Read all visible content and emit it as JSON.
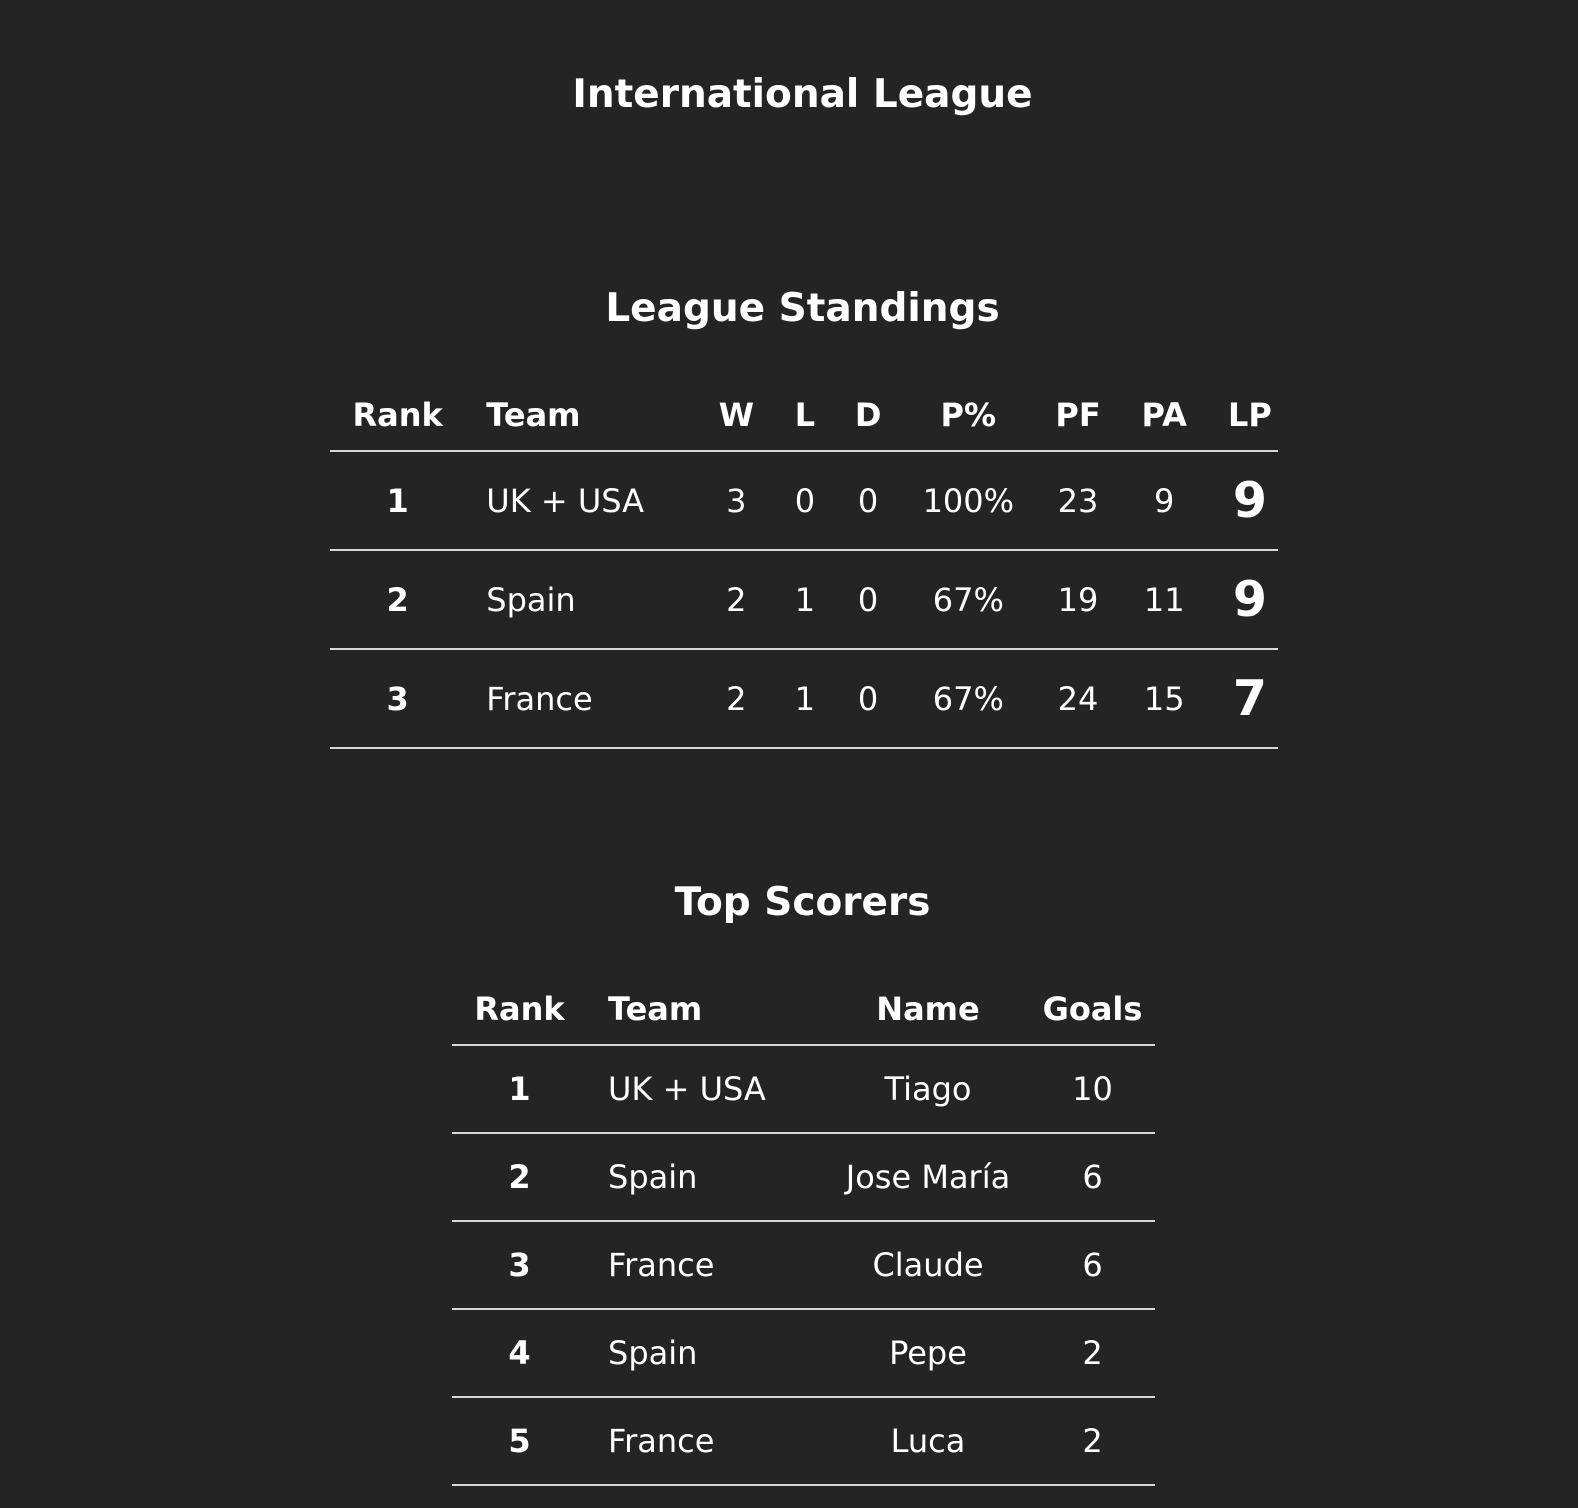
{
  "page": {
    "title": "International League"
  },
  "standings": {
    "title": "League Standings",
    "headers": {
      "rank": "Rank",
      "team": "Team",
      "w": "W",
      "l": "L",
      "d": "D",
      "pct": "P%",
      "pf": "PF",
      "pa": "PA",
      "lp": "LP"
    },
    "rows": [
      {
        "rank": "1",
        "team": "UK + USA",
        "w": "3",
        "l": "0",
        "d": "0",
        "pct": "100%",
        "pf": "23",
        "pa": "9",
        "lp": "9"
      },
      {
        "rank": "2",
        "team": "Spain",
        "w": "2",
        "l": "1",
        "d": "0",
        "pct": "67%",
        "pf": "19",
        "pa": "11",
        "lp": "9"
      },
      {
        "rank": "3",
        "team": "France",
        "w": "2",
        "l": "1",
        "d": "0",
        "pct": "67%",
        "pf": "24",
        "pa": "15",
        "lp": "7"
      }
    ]
  },
  "scorers": {
    "title": "Top Scorers",
    "headers": {
      "rank": "Rank",
      "team": "Team",
      "name": "Name",
      "goals": "Goals"
    },
    "rows": [
      {
        "rank": "1",
        "team": "UK + USA",
        "name": "Tiago",
        "goals": "10"
      },
      {
        "rank": "2",
        "team": "Spain",
        "name": "Jose María",
        "goals": "6"
      },
      {
        "rank": "3",
        "team": "France",
        "name": "Claude",
        "goals": "6"
      },
      {
        "rank": "4",
        "team": "Spain",
        "name": "Pepe",
        "goals": "2"
      },
      {
        "rank": "5",
        "team": "France",
        "name": "Luca",
        "goals": "2"
      }
    ]
  },
  "colors": {
    "background": "#242424",
    "text": "#ffffff",
    "divider": "#d8d8d8"
  }
}
